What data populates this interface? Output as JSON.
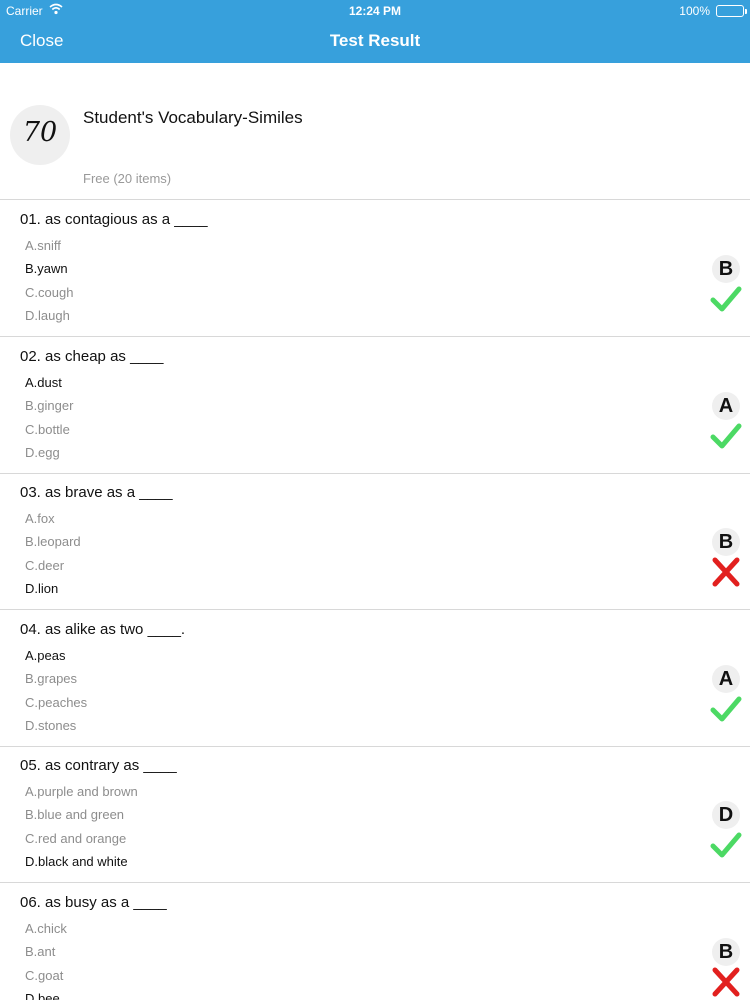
{
  "status_bar": {
    "carrier": "Carrier",
    "time": "12:24 PM",
    "battery": "100%"
  },
  "nav": {
    "close": "Close",
    "title": "Test Result"
  },
  "test": {
    "score": "70",
    "title": "Student's Vocabulary-Similes",
    "meta": "Free (20 items)"
  },
  "colors": {
    "nav_bg": "#37a0dc",
    "correct": "#4cd964",
    "wrong": "#e2201f"
  },
  "questions": [
    {
      "text": "01. as contagious as a ____",
      "options": [
        "A.sniff",
        "B.yawn",
        "C.cough",
        "D.laugh"
      ],
      "selected": 1,
      "answer": "B",
      "result": "correct"
    },
    {
      "text": "02. as cheap as ____",
      "options": [
        "A.dust",
        "B.ginger",
        "C.bottle",
        "D.egg"
      ],
      "selected": 0,
      "answer": "A",
      "result": "correct"
    },
    {
      "text": "03. as brave as a ____",
      "options": [
        "A.fox",
        "B.leopard",
        "C.deer",
        "D.lion"
      ],
      "selected": 3,
      "answer": "B",
      "result": "wrong"
    },
    {
      "text": "04. as alike as two ____.",
      "options": [
        "A.peas",
        "B.grapes",
        "C.peaches",
        "D.stones"
      ],
      "selected": 0,
      "answer": "A",
      "result": "correct"
    },
    {
      "text": "05. as contrary as ____",
      "options": [
        "A.purple and brown",
        "B.blue and green",
        "C.red and orange",
        "D.black and white"
      ],
      "selected": 3,
      "answer": "D",
      "result": "correct"
    },
    {
      "text": "06. as busy as a ____",
      "options": [
        "A.chick",
        "B.ant",
        "C.goat",
        "D.bee"
      ],
      "selected": 3,
      "answer": "B",
      "result": "wrong"
    }
  ]
}
